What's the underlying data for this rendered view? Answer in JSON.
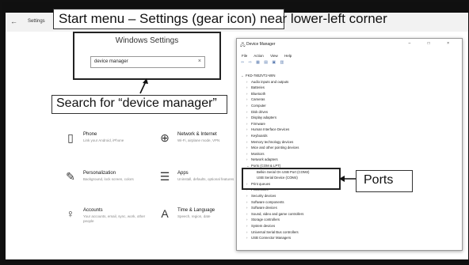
{
  "settings": {
    "back_icon": "back-arrow-icon",
    "title": "Settings",
    "panel_title": "Windows Settings",
    "search_value": "device manager",
    "tiles": [
      {
        "icon": "phone-icon",
        "glyph": "▯",
        "title": "Phone",
        "subtitle": "Link your Android, iPhone"
      },
      {
        "icon": "globe-icon",
        "glyph": "⊕",
        "title": "Network & Internet",
        "subtitle": "Wi-Fi, airplane mode, VPN"
      },
      {
        "icon": "personalization-icon",
        "glyph": "✎",
        "title": "Personalization",
        "subtitle": "Background, lock screen, colors"
      },
      {
        "icon": "apps-icon",
        "glyph": "☰",
        "title": "Apps",
        "subtitle": "Uninstall, defaults, optional features"
      },
      {
        "icon": "person-icon",
        "glyph": "♀",
        "title": "Accounts",
        "subtitle": "Your accounts, email, sync, work, other people"
      },
      {
        "icon": "language-icon",
        "glyph": "A",
        "title": "Time & Language",
        "subtitle": "Speech, region, date"
      }
    ]
  },
  "device_manager": {
    "title": "Device Manager",
    "controls": "– □ ×",
    "menu": [
      "File",
      "Action",
      "View",
      "Help"
    ],
    "toolbar": "⇦ ⇨ ▦ ▤ ▣ ▥",
    "tree": [
      {
        "label": "FKD-780ZVT2-WIN",
        "indent": 0,
        "expand": "⌄"
      },
      {
        "label": "Audio inputs and outputs",
        "indent": 1,
        "expand": "›"
      },
      {
        "label": "Batteries",
        "indent": 1,
        "expand": "›"
      },
      {
        "label": "Bluetooth",
        "indent": 1,
        "expand": "›"
      },
      {
        "label": "Cameras",
        "indent": 1,
        "expand": "›"
      },
      {
        "label": "Computer",
        "indent": 1,
        "expand": "›"
      },
      {
        "label": "Disk drives",
        "indent": 1,
        "expand": "›"
      },
      {
        "label": "Display adapters",
        "indent": 1,
        "expand": "›"
      },
      {
        "label": "Firmware",
        "indent": 1,
        "expand": "›"
      },
      {
        "label": "Human Interface Devices",
        "indent": 1,
        "expand": "›"
      },
      {
        "label": "Keyboards",
        "indent": 1,
        "expand": "›"
      },
      {
        "label": "Memory technology devices",
        "indent": 1,
        "expand": "›"
      },
      {
        "label": "Mice and other pointing devices",
        "indent": 1,
        "expand": "›"
      },
      {
        "label": "Monitors",
        "indent": 1,
        "expand": "›"
      },
      {
        "label": "Network adapters",
        "indent": 1,
        "expand": "›"
      },
      {
        "label": "Ports (COM & LPT)",
        "indent": 1,
        "expand": "⌄"
      },
      {
        "label": "Belkin Serial On USB Port (COM3)",
        "indent": 2,
        "expand": ""
      },
      {
        "label": "USB Serial Device (COM4)",
        "indent": 2,
        "expand": ""
      },
      {
        "label": "Print queues",
        "indent": 1,
        "expand": "›"
      },
      {
        "label": "Processors",
        "indent": 1,
        "expand": "›"
      },
      {
        "label": "Security devices",
        "indent": 1,
        "expand": "›"
      },
      {
        "label": "Software components",
        "indent": 1,
        "expand": "›"
      },
      {
        "label": "Software devices",
        "indent": 1,
        "expand": "›"
      },
      {
        "label": "Sound, video and game controllers",
        "indent": 1,
        "expand": "›"
      },
      {
        "label": "Storage controllers",
        "indent": 1,
        "expand": "›"
      },
      {
        "label": "System devices",
        "indent": 1,
        "expand": "›"
      },
      {
        "label": "Universal Serial Bus controllers",
        "indent": 1,
        "expand": "›"
      },
      {
        "label": "USB Connector Managers",
        "indent": 1,
        "expand": "›"
      }
    ]
  },
  "annotations": {
    "start_menu": "Start menu – Settings (gear icon) near lower-left corner",
    "search": "Search for “device manager”",
    "ports": "Ports"
  }
}
